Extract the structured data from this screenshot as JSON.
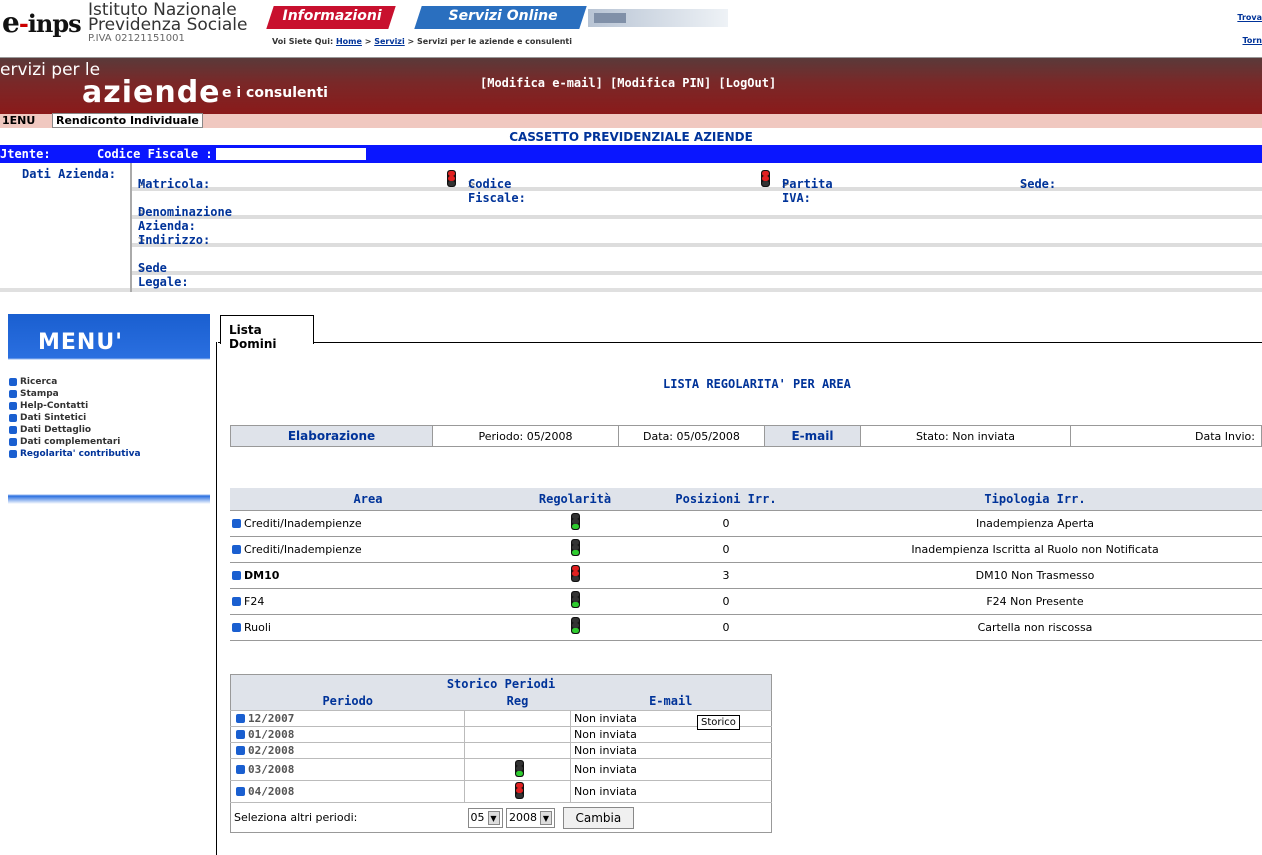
{
  "header": {
    "logo": "e-inps",
    "institute_line1": "Istituto Nazionale",
    "institute_line2": "Previdenza Sociale",
    "piva": "P.IVA 02121151001",
    "tab_informazioni": "Informazioni",
    "tab_servizi": "Servizi Online",
    "breadcrumb_prefix": "Voi Siete Qui:",
    "breadcrumb_home": "Home",
    "breadcrumb_servizi": "Servizi",
    "breadcrumb_current": "> Servizi per le aziende e consulenti",
    "right_link1": "Trova",
    "right_link2": "Torn"
  },
  "banner": {
    "line1": "ervizi per le",
    "line2": "aziende",
    "line3": "e i consulenti",
    "links": "[Modifica e-mail] [Modifica PIN] [LogOut]"
  },
  "crumbbar": {
    "menu": "1ENU",
    "current": "Rendiconto Individuale"
  },
  "cassetto_title": "CASSETTO PREVIDENZIALE AZIENDE",
  "utente": {
    "label": "Jtente:",
    "cf_label": "Codice Fiscale :"
  },
  "dati_azienda": {
    "label": "Dati Azienda:",
    "matricola": "Matricola:",
    "codice_fiscale": "Codice Fiscale:",
    "partita_iva": "Partita IVA:",
    "sede": "Sede:",
    "denominazione": "Denominazione Azienda:",
    "indirizzo": "Indirizzo:",
    "sede_legale": "Sede Legale:"
  },
  "sidemenu": {
    "title": "MENU'",
    "items": [
      "Ricerca",
      "Stampa",
      "Help-Contatti",
      "Dati Sintetici",
      "Dati Dettaglio",
      "Dati complementari",
      "Regolarita' contributiva"
    ]
  },
  "tab_lista": "Lista Domini",
  "lista_title": "LISTA REGOLARITA' PER AREA",
  "elaborazione": {
    "label": "Elaborazione",
    "periodo_label": "Periodo:",
    "periodo": "05/2008",
    "data_label": "Data:",
    "data": "05/05/2008",
    "email_label": "E-mail",
    "stato_label": "Stato:",
    "stato": "Non inviata",
    "data_invio_label": "Data Invio:"
  },
  "reg_table": {
    "headers": [
      "Area",
      "Regolarità",
      "Posizioni Irr.",
      "Tipologia Irr."
    ],
    "rows": [
      {
        "area": "Crediti/Inadempienze",
        "light": "green",
        "pos": "0",
        "tipo": "Inadempienza Aperta"
      },
      {
        "area": "Crediti/Inadempienze",
        "light": "green",
        "pos": "0",
        "tipo": "Inadempienza Iscritta al Ruolo non Notificata"
      },
      {
        "area": "DM10",
        "light": "red",
        "pos": "3",
        "tipo": "DM10 Non Trasmesso"
      },
      {
        "area": "F24",
        "light": "green",
        "pos": "0",
        "tipo": "F24 Non Presente"
      },
      {
        "area": "Ruoli",
        "light": "green",
        "pos": "0",
        "tipo": "Cartella non riscossa"
      }
    ]
  },
  "storico": {
    "title": "Storico Periodi",
    "headers": [
      "Periodo",
      "Reg",
      "E-mail"
    ],
    "rows": [
      {
        "periodo": "12/2007",
        "light": "",
        "email": "Non inviata"
      },
      {
        "periodo": "01/2008",
        "light": "",
        "email": "Non inviata"
      },
      {
        "periodo": "02/2008",
        "light": "",
        "email": "Non inviata"
      },
      {
        "periodo": "03/2008",
        "light": "green",
        "email": "Non inviata"
      },
      {
        "periodo": "04/2008",
        "light": "red",
        "email": "Non inviata"
      }
    ],
    "select_label": "Seleziona altri periodi:",
    "month_value": "05",
    "year_value": "2008",
    "button_label": "Cambia",
    "tooltip": "Storico"
  },
  "colors": {
    "primary_blue": "#003399",
    "utente_bar": "#0a16ff",
    "banner_red": "#8a1a1a",
    "table_header": "#dfe3ea",
    "light_green": "#2fcc2f",
    "light_red": "#e02020"
  }
}
